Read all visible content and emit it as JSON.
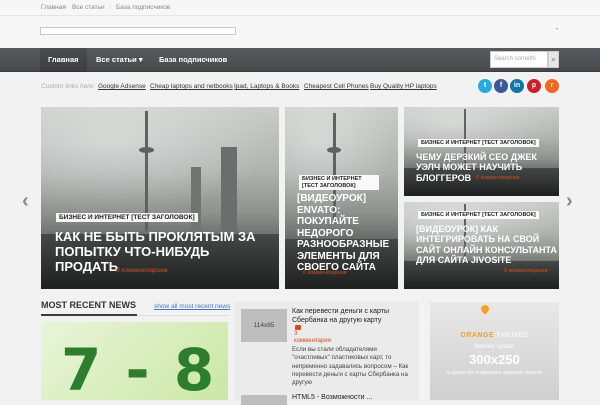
{
  "breadcrumb": {
    "home": "Главная",
    "all": "Все статьи",
    "base": "База подписчиков"
  },
  "nav": {
    "items": [
      {
        "label": "Главная"
      },
      {
        "label": "Все статьи ▾"
      },
      {
        "label": "База подписчиков"
      }
    ],
    "search_placeholder": "Search somethi"
  },
  "custom_links": {
    "label": "Custom links here:",
    "links": [
      "Google Adsense",
      "Cheap laptops and netbooks",
      "Ipad, Laptops & Books",
      "Cheapest Cell Phones",
      "Buy Quality HP laptops"
    ]
  },
  "social": [
    {
      "icon": "twitter-icon",
      "glyph": "t",
      "color": "#2aa9e0"
    },
    {
      "icon": "facebook-icon",
      "glyph": "f",
      "color": "#3b5998"
    },
    {
      "icon": "linkedin-icon",
      "glyph": "in",
      "color": "#0e76a8"
    },
    {
      "icon": "pinterest-icon",
      "glyph": "p",
      "color": "#cb2027"
    },
    {
      "icon": "rss-icon",
      "glyph": "r",
      "color": "#f26522"
    }
  ],
  "slider": {
    "main": {
      "tag": "Бизнес и интернет [тест заголовок]",
      "title": "Как не быть проклятым за попытку что-нибудь продать",
      "meta": "0 комментариев"
    },
    "mid": {
      "tag": "Бизнес и интернет [тест заголовок]",
      "title": "[Видеоурок] Envato: покупайте недорого разнообразные элементы для своего сайта",
      "meta": "0 комментариев"
    },
    "right_top": {
      "tag": "Бизнес и интернет [тест заголовок]",
      "title": "Чему Дерзкий сео Джек Уэлч может научить блоггеров",
      "meta": "0 комментариев"
    },
    "right_bottom": {
      "tag": "Бизнес и интернет [тест заголовок]",
      "title": "[Видеоурок] Как интегрировать на свой сайт онлайн консультанта для сайта Jivosite",
      "meta": "0 комментариев"
    }
  },
  "recent": {
    "heading": "MOST RECENT NEWS",
    "show_all": "show all most recent news",
    "image_text": "7 - 8",
    "post": {
      "thumb": "114x85",
      "title": "Как перевести деньги с карты Сбербанка на другую карту",
      "comments": "3",
      "comments_label": "комментария",
      "excerpt": "Если вы стали обладателями \"счастливых\" пластиковых карт, то непременно задавались вопросом – Как перевести деньги с карты Сбербанка на другую"
    },
    "post2_title": "HTML5 - Возможности ..."
  },
  "banner": {
    "brand_1": "ORANGE",
    "brand_2": " THEMES",
    "line1": "banner space",
    "size": "300x250",
    "line3": "a space for responsive adsense banner"
  }
}
